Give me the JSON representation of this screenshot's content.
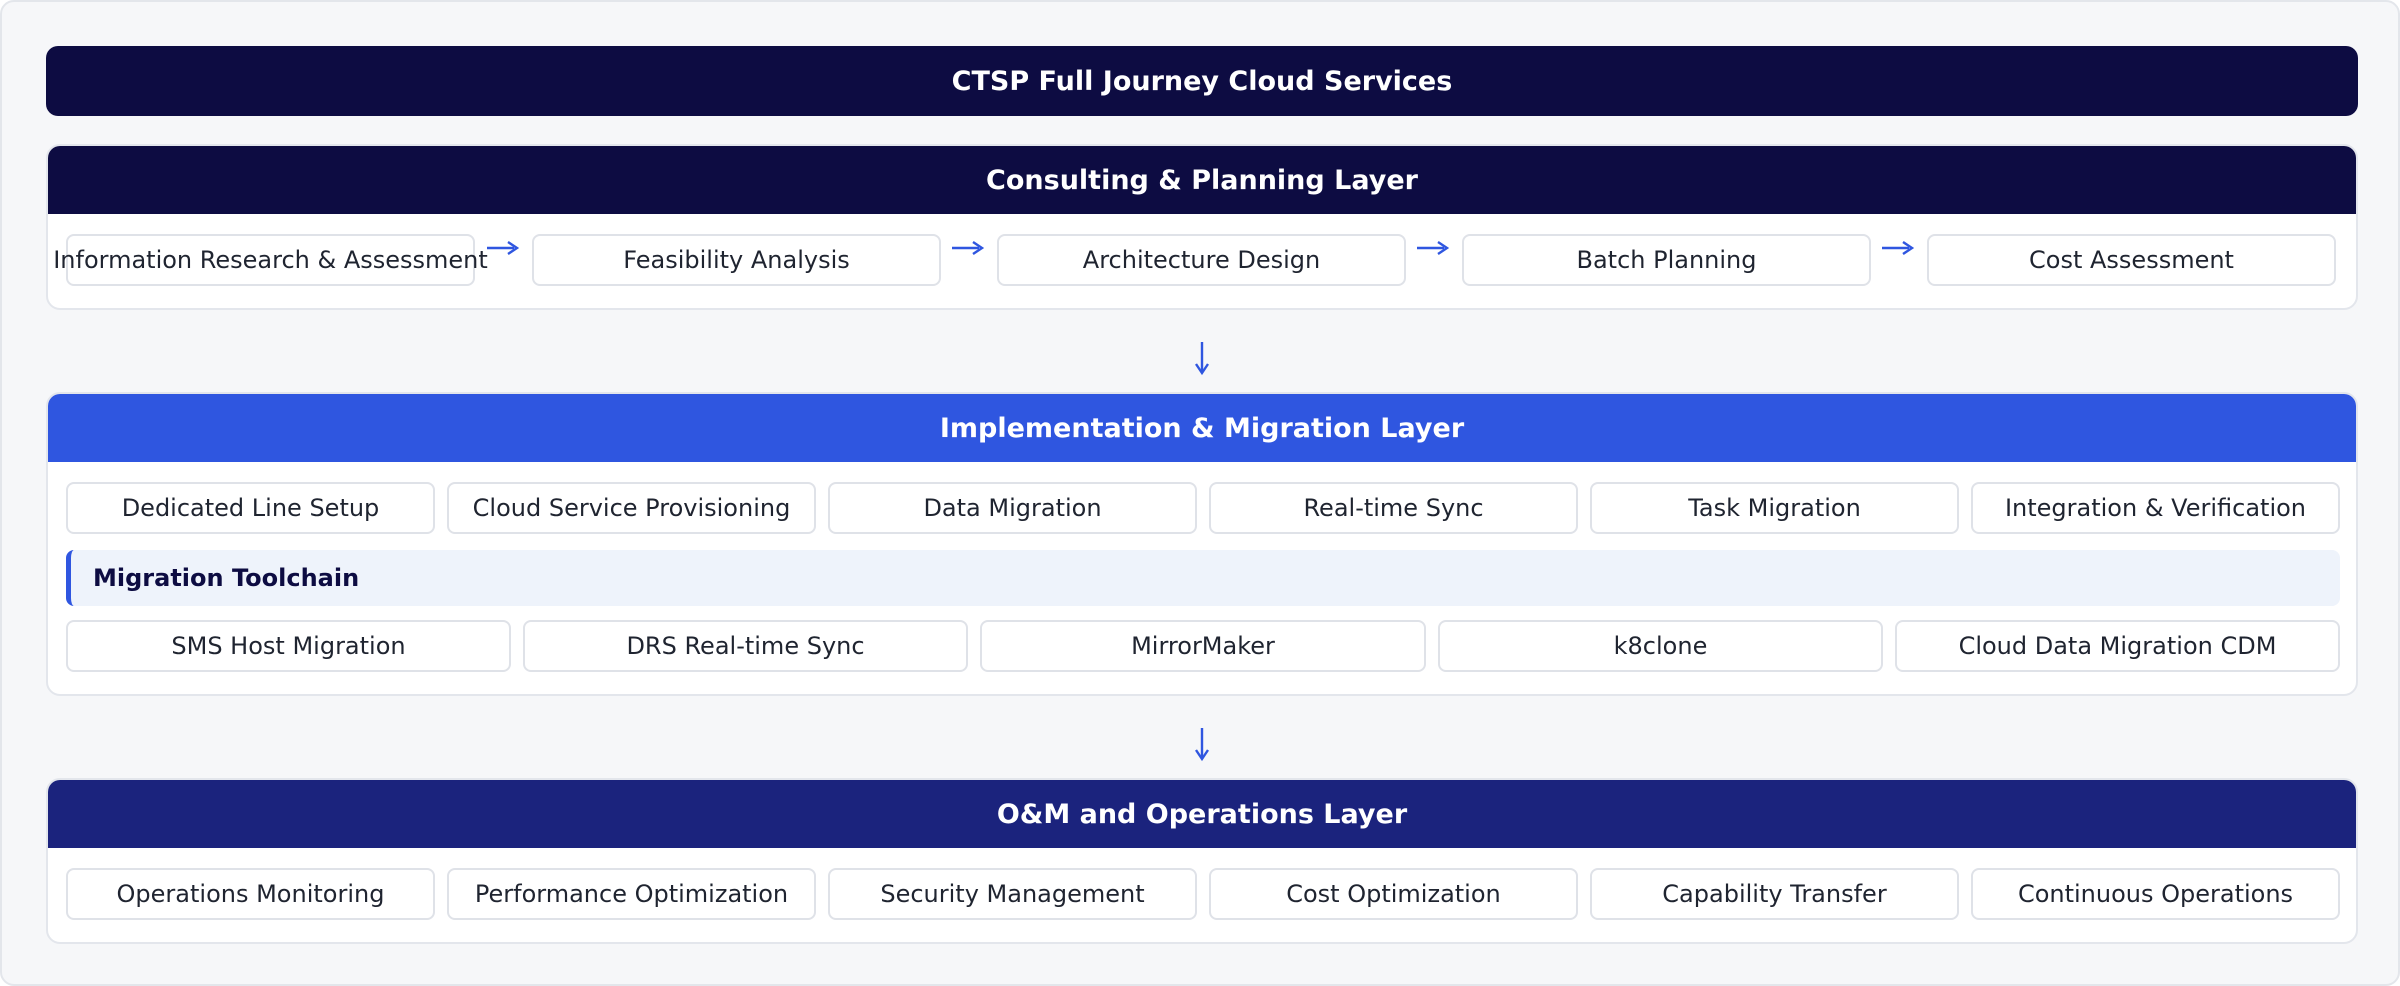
{
  "title": "CTSP Full Journey Cloud Services",
  "colors": {
    "title_bg": "#0d0c42",
    "consulting_header": "#0d0c42",
    "implementation_header": "#2f56e0",
    "operations_header": "#1b237d",
    "arrow": "#2f56e0"
  },
  "consulting": {
    "header": "Consulting & Planning Layer",
    "steps": [
      "Information Research & Assessment",
      "Feasibility Analysis",
      "Architecture Design",
      "Batch Planning",
      "Cost Assessment"
    ],
    "arrow_glyph": "⟶"
  },
  "implementation": {
    "header": "Implementation & Migration Layer",
    "steps": [
      "Dedicated Line Setup",
      "Cloud Service Provisioning",
      "Data Migration",
      "Real-time Sync",
      "Task Migration",
      "Integration & Verification"
    ],
    "toolchain": {
      "label": "Migration Toolchain",
      "tools": [
        "SMS Host Migration",
        "DRS Real-time Sync",
        "MirrorMaker",
        "k8clone",
        "Cloud Data Migration CDM"
      ]
    }
  },
  "operations": {
    "header": "O&M and Operations Layer",
    "steps": [
      "Operations Monitoring",
      "Performance Optimization",
      "Security Management",
      "Cost Optimization",
      "Capability Transfer",
      "Continuous Operations"
    ]
  },
  "down_arrow_glyph": "↓"
}
